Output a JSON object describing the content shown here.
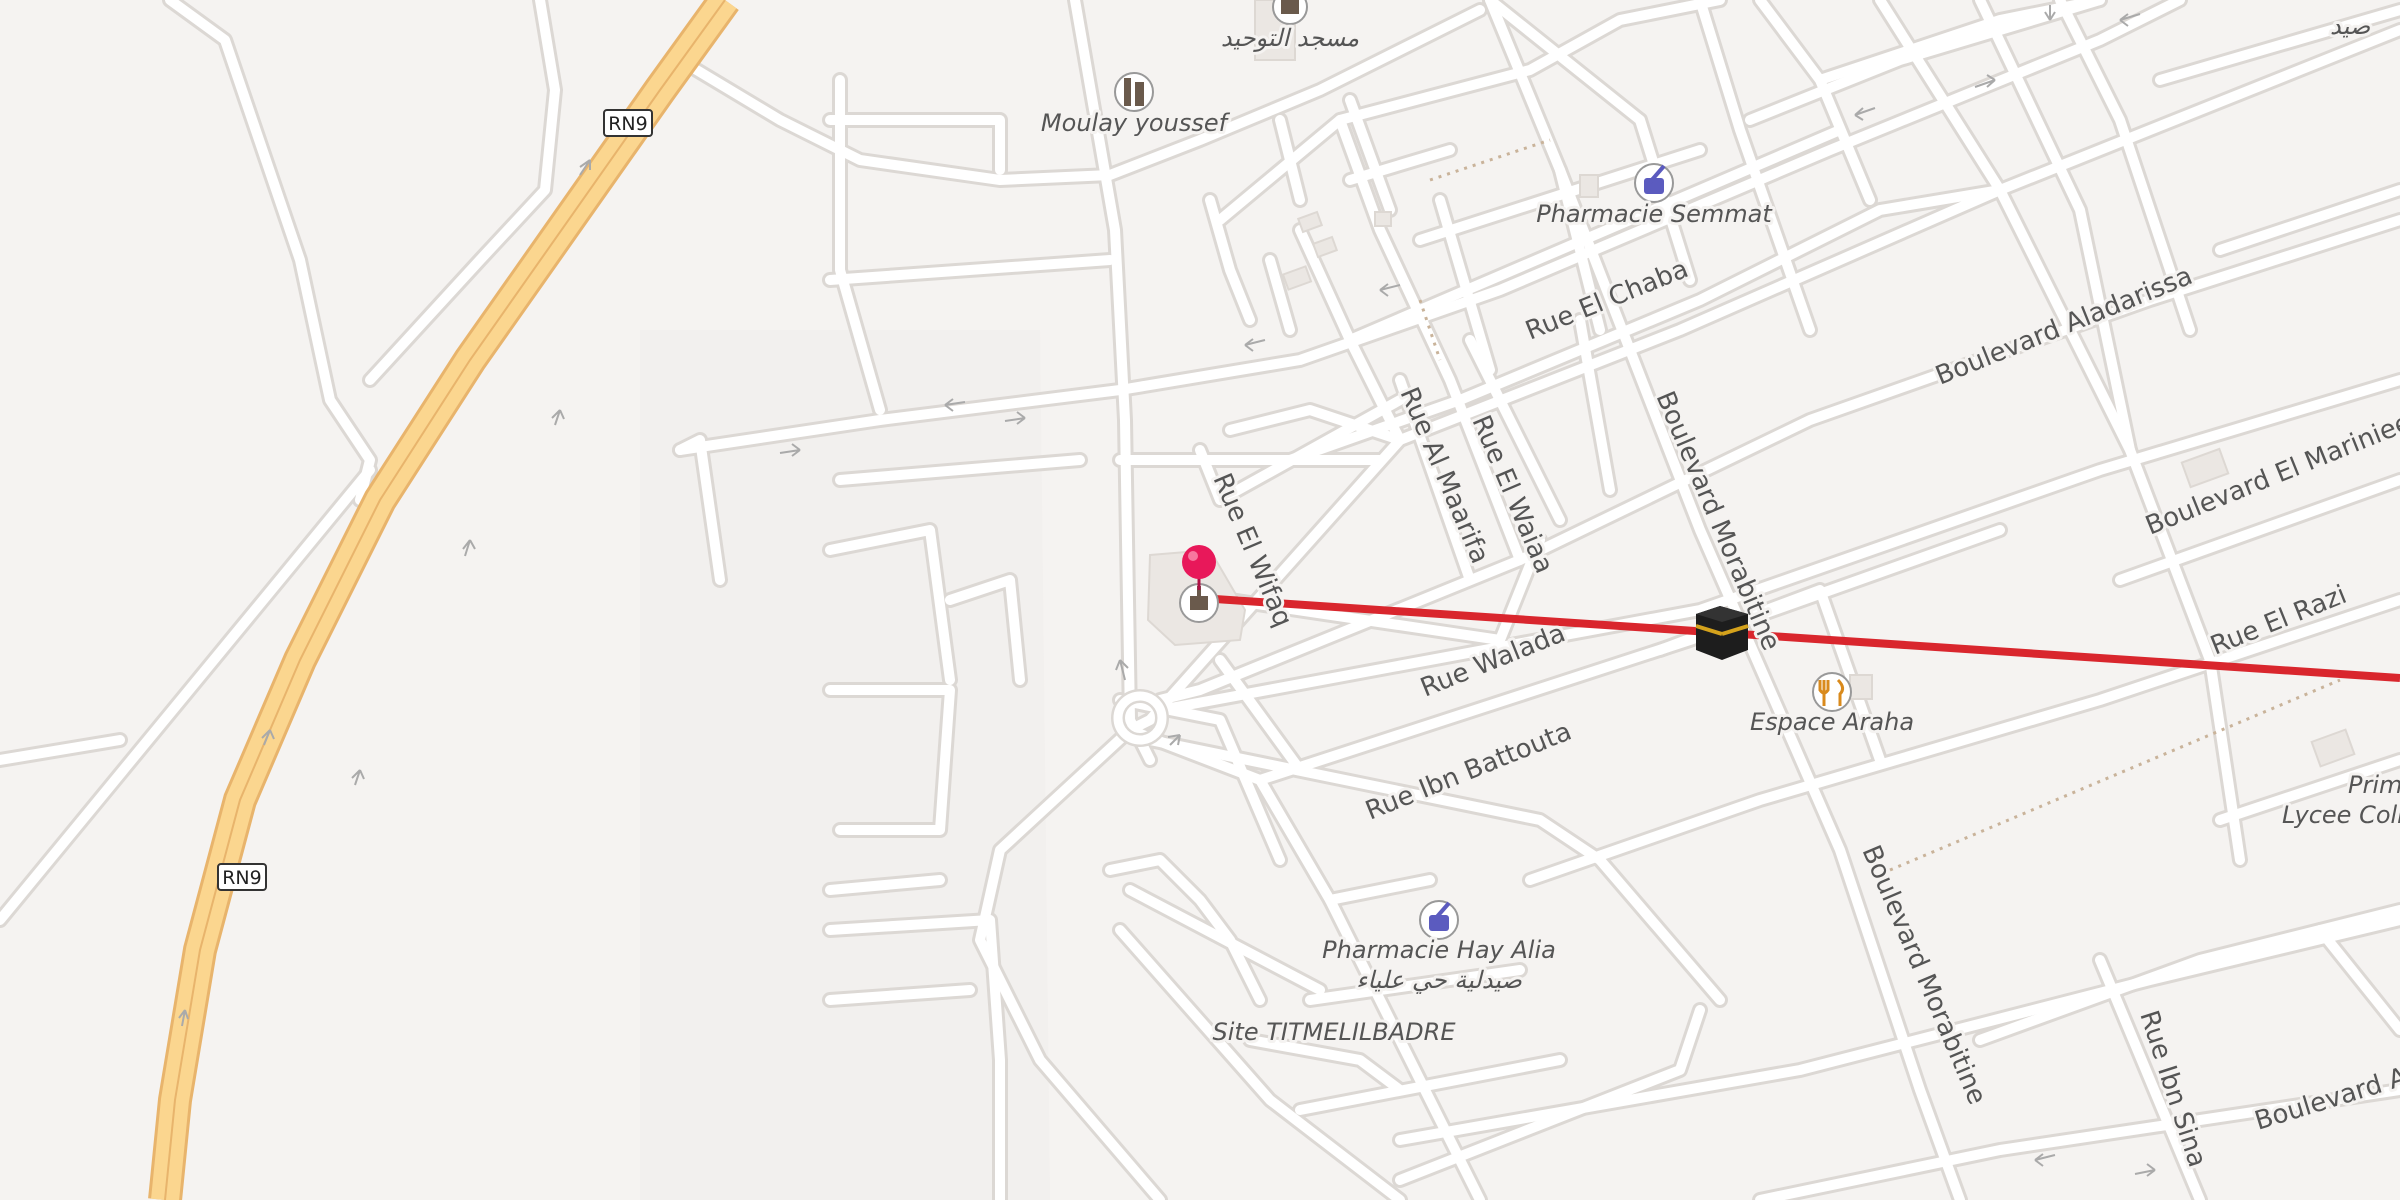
{
  "map": {
    "road_shields": [
      "RN9",
      "RN9"
    ],
    "streets": [
      "Rue El Chaba",
      "Boulevard Aladarissa",
      "Boulevard El Marinieen",
      "Rue El Razi",
      "Rue Walada",
      "Rue Ibn Battouta",
      "Rue El Wifaq",
      "Rue Al Maarifa",
      "Rue El Waiaa",
      "Boulevard Morabitine",
      "Boulevard Morabitine",
      "Rue Ibn Sina",
      "Boulevard A"
    ],
    "pois": {
      "mosque_top": "مسجد التوحيد",
      "moulay": "Moulay youssef",
      "pharmacie_semmat": "Pharmacie Semmat",
      "espace_araha": "Espace Araha",
      "pharmacie_alia": "Pharmacie Hay Alia",
      "pharmacie_alia_ar": "صيدلية حي علياء",
      "site": "Site TITMELILBADRE",
      "primaire": "Primaire",
      "lycee": "Lycee Colleg",
      "top_right_ar": "صيد"
    },
    "icons": [
      "mosque-icon",
      "landmark-icon",
      "pharmacy-icon",
      "restaurant-icon",
      "kaaba-icon",
      "location-pin-icon"
    ],
    "colors": {
      "background": "#f5f3f1",
      "road": "#ffffff",
      "road_casing": "#dedbd7",
      "highway": "#fbd68f",
      "highway_casing": "#e8b46c",
      "qibla_line": "#d9262d",
      "pin": "#e8185a",
      "pharmacy": "#5b5bbf",
      "restaurant": "#d98a1c"
    }
  }
}
